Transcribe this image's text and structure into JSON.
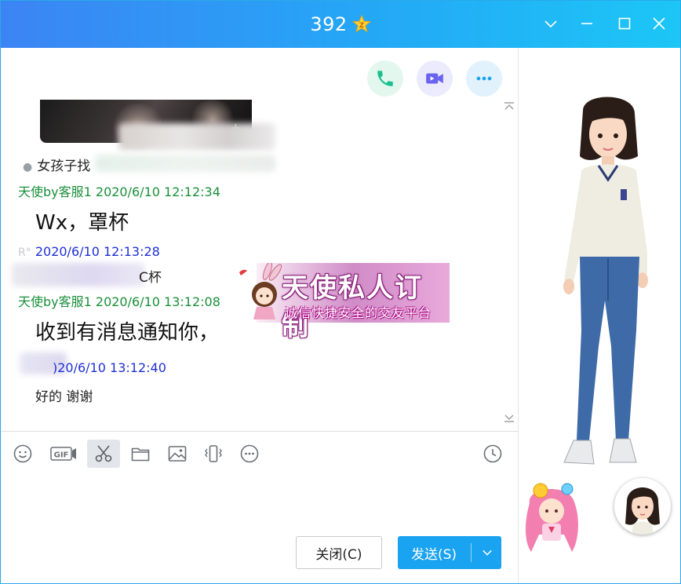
{
  "window": {
    "title": "392",
    "title_badge_icon": "star-z-icon",
    "controls": [
      "chevron-down-icon",
      "minimize-icon",
      "maximize-icon",
      "close-icon"
    ]
  },
  "header_actions": [
    {
      "name": "voice-call",
      "icon": "phone-icon",
      "color": "#1bc08f"
    },
    {
      "name": "video-call",
      "icon": "video-camera-icon",
      "color": "#6a63f0"
    },
    {
      "name": "more",
      "icon": "more-dots-icon",
      "color": "#1aa3f0"
    }
  ],
  "messages": {
    "bullet_text": "女孩子找",
    "msg1": {
      "sender_time": "天使by客服1 2020/6/10 12:12:34",
      "text": "Wx，罩杯"
    },
    "msg2": {
      "sender_prefix": "R°",
      "time": "2020/6/10 12:13:28",
      "text_suffix": "C杯"
    },
    "msg3": {
      "sender_time": "天使by客服1 2020/6/10 13:12:08",
      "text": "收到有消息通知你，"
    },
    "msg4": {
      "time_partial": ")20/6/10 13:12:40",
      "text": "好的 谢谢"
    }
  },
  "banner": {
    "title": "天使私人订制",
    "subtitle": "诚信快捷安全的交友平台"
  },
  "toolbar": {
    "tools": [
      "emoji-icon",
      "gif-icon",
      "scissors-icon",
      "folder-icon",
      "image-icon",
      "shake-icon",
      "more-circle-icon"
    ],
    "active_tool": "scissors-icon",
    "history_icon": "clock-icon",
    "gif_label": "GIF"
  },
  "buttons": {
    "close_label": "关闭(C)",
    "send_label": "发送(S)"
  },
  "colors": {
    "accent": "#1aa3f0",
    "sender_green": "#1a8f3a",
    "time_blue": "#1f2fd6"
  }
}
